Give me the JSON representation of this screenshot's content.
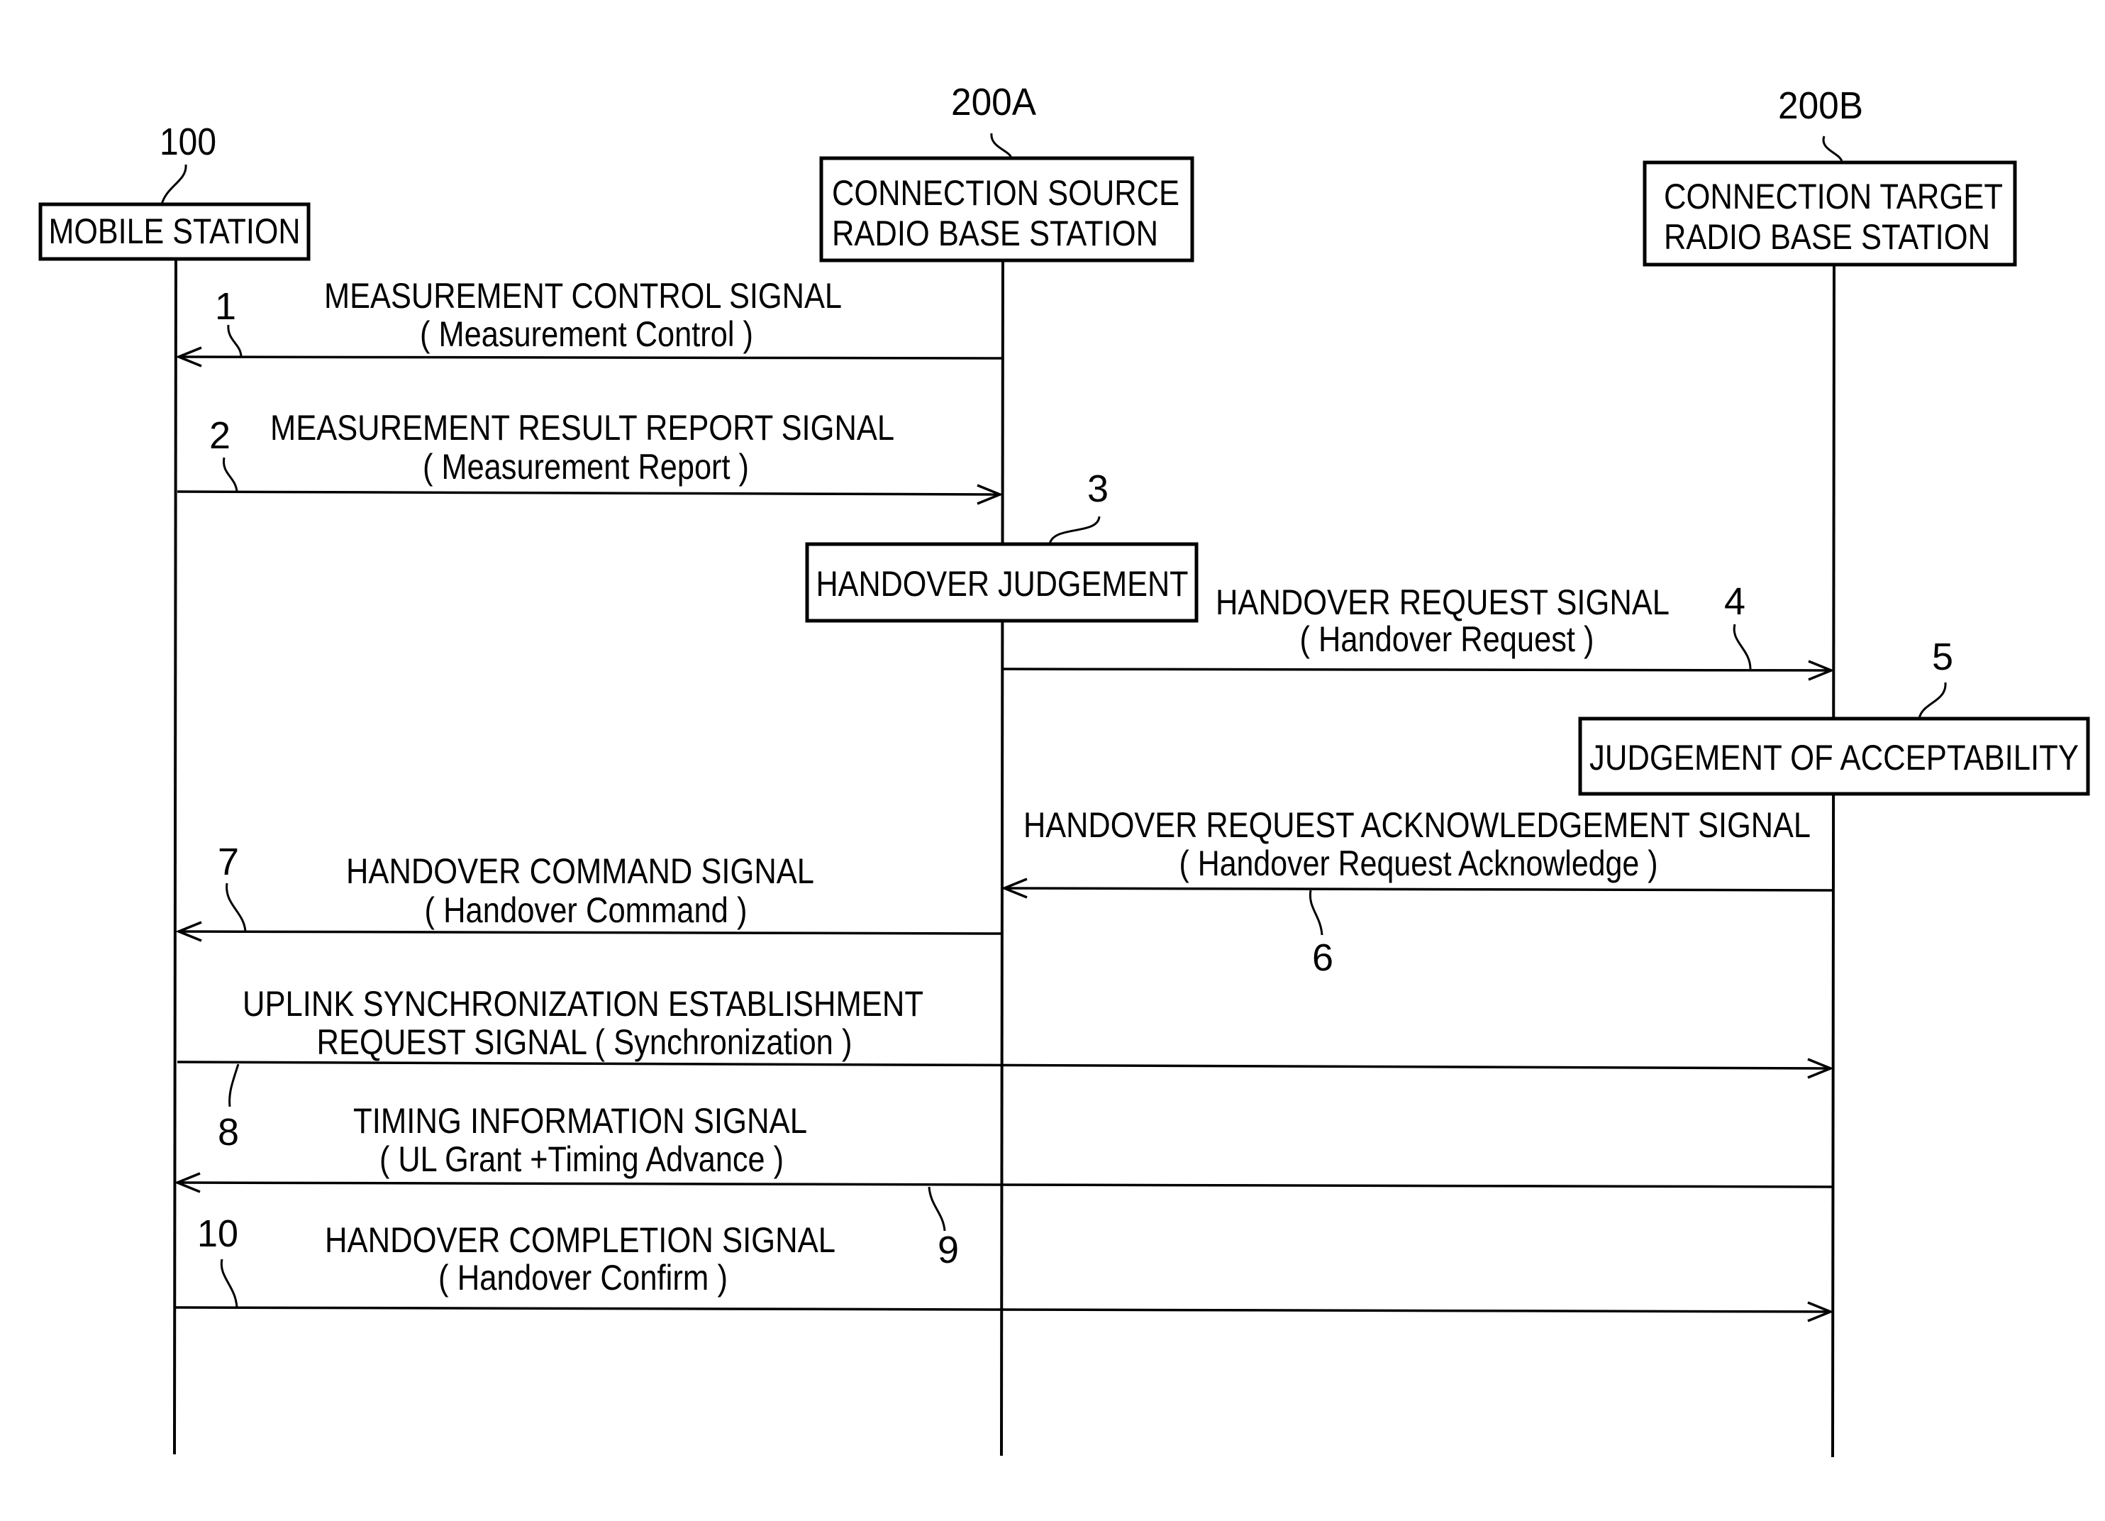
{
  "entities": [
    {
      "id": "mobile",
      "ref": "100",
      "label_lines": [
        "MOBILE STATION"
      ]
    },
    {
      "id": "source",
      "ref": "200A",
      "label_lines": [
        "CONNECTION SOURCE",
        "RADIO BASE STATION"
      ]
    },
    {
      "id": "target",
      "ref": "200B",
      "label_lines": [
        "CONNECTION TARGET",
        "RADIO BASE STATION"
      ]
    }
  ],
  "processes": [
    {
      "step": "3",
      "label": "HANDOVER JUDGEMENT",
      "at": "source"
    },
    {
      "step": "5",
      "label": "JUDGEMENT OF ACCEPTABILITY",
      "at": "target"
    }
  ],
  "messages": [
    {
      "step": "1",
      "from": "source",
      "to": "mobile",
      "line1": "MEASUREMENT CONTROL SIGNAL",
      "line2": "( Measurement Control )"
    },
    {
      "step": "2",
      "from": "mobile",
      "to": "source",
      "line1": "MEASUREMENT RESULT REPORT SIGNAL",
      "line2": "( Measurement Report )"
    },
    {
      "step": "4",
      "from": "source",
      "to": "target",
      "line1": "HANDOVER REQUEST SIGNAL",
      "line2": "( Handover Request )"
    },
    {
      "step": "6",
      "from": "target",
      "to": "source",
      "line1": "HANDOVER REQUEST ACKNOWLEDGEMENT SIGNAL",
      "line2": "( Handover Request Acknowledge )"
    },
    {
      "step": "7",
      "from": "source",
      "to": "mobile",
      "line1": "HANDOVER COMMAND SIGNAL",
      "line2": "( Handover Command )"
    },
    {
      "step": "8",
      "from": "mobile",
      "to": "target",
      "line1": "UPLINK SYNCHRONIZATION ESTABLISHMENT",
      "line2": "REQUEST SIGNAL ( Synchronization )"
    },
    {
      "step": "9",
      "from": "target",
      "to": "mobile",
      "line1": "TIMING INFORMATION SIGNAL",
      "line2": "( UL Grant +Timing Advance )"
    },
    {
      "step": "10",
      "from": "mobile",
      "to": "target",
      "line1": "HANDOVER COMPLETION SIGNAL",
      "line2": "( Handover Confirm )"
    }
  ]
}
